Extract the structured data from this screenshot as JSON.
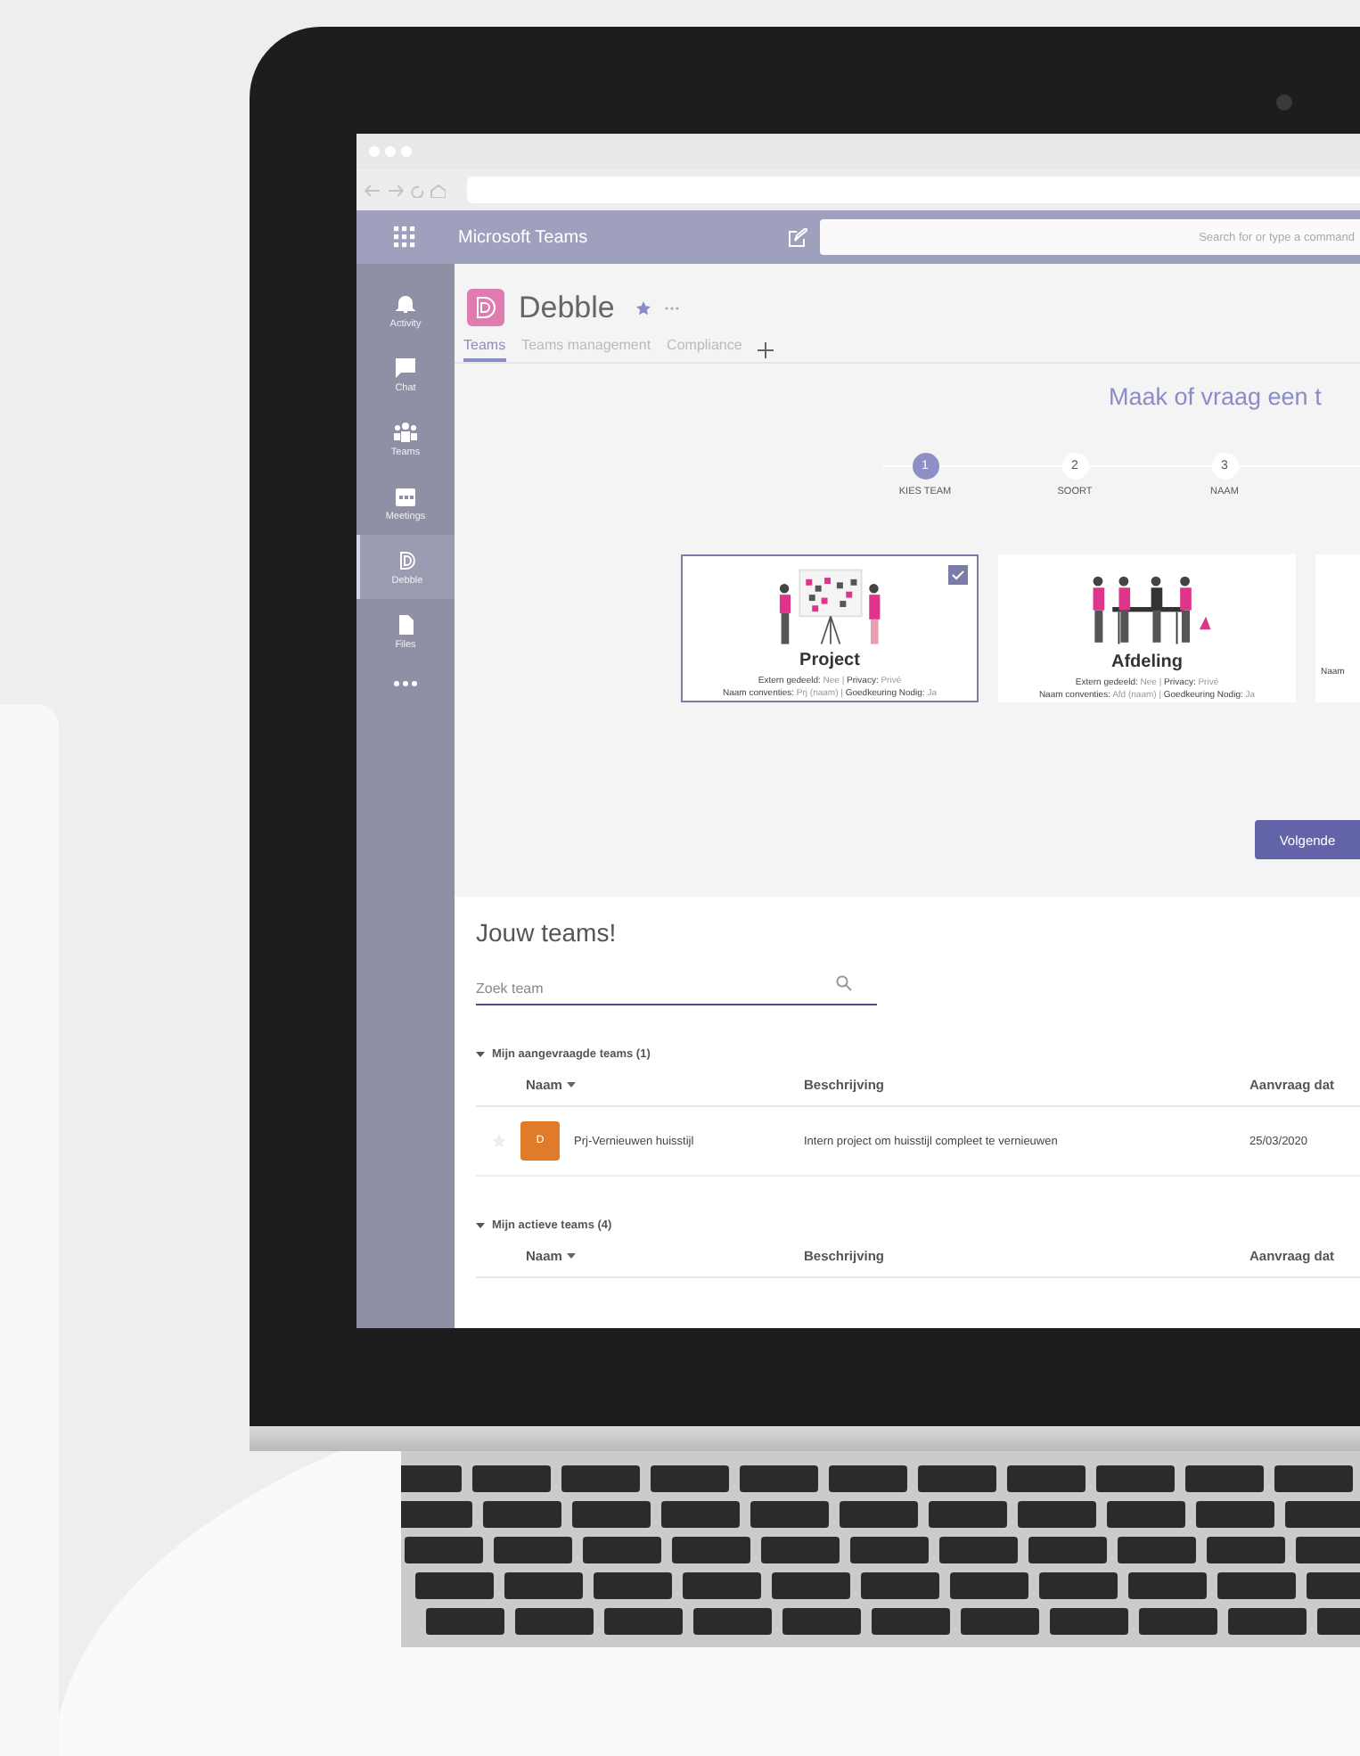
{
  "app_bar": {
    "title": "Microsoft Teams",
    "search_placeholder": "Search for or type a command"
  },
  "rail": [
    {
      "kind": "activity",
      "label": "Activity",
      "selected": false
    },
    {
      "kind": "chat",
      "label": "Chat",
      "selected": false
    },
    {
      "kind": "teams",
      "label": "Teams",
      "selected": false
    },
    {
      "kind": "meetings",
      "label": "Meetings",
      "selected": false
    },
    {
      "kind": "debble",
      "label": "Debble",
      "selected": true
    },
    {
      "kind": "files",
      "label": "Files",
      "selected": false
    }
  ],
  "app_header": {
    "name": "Debble",
    "tabs": [
      {
        "label": "Teams",
        "selected": true
      },
      {
        "label": "Teams management",
        "selected": false
      },
      {
        "label": "Compliance",
        "selected": false
      }
    ]
  },
  "wizard": {
    "title": "Maak of vraag een t",
    "steps": [
      {
        "number": "1",
        "label": "KIES TEAM",
        "selected": true
      },
      {
        "number": "2",
        "label": "SOORT",
        "selected": false
      },
      {
        "number": "3",
        "label": "NAAM",
        "selected": false
      }
    ],
    "cards": [
      {
        "kind": "project",
        "title": "Project",
        "line_1": "**Extern gedeeld:** Nee | **Privacy:** Privé",
        "line_2": "**Naam conventies:** Prj (naam) | **Goedkeuring Nodig:** Ja",
        "checked": true
      },
      {
        "kind": "department",
        "title": "Afdeling",
        "line_1": "**Extern gedeeld:** Nee | **Privacy:** Privé",
        "line_2": "**Naam conventies:** Afd (naam) | **Goedkeuring Nodig:** Ja",
        "checked": false
      },
      {
        "kind": "partial",
        "line_2": "**Naam**",
        "checked": false
      }
    ],
    "next_button": "Volgende"
  },
  "teams": {
    "title": "Jouw teams!",
    "search_placeholder": "Zoek team",
    "groups": [
      {
        "label": "Mijn aangevraagde teams (1)",
        "expanded": true,
        "columns": [
          "Naam",
          "Beschrijving",
          "Aanvraag dat"
        ],
        "rows": [
          {
            "initial": "D",
            "color": "#e07b2a",
            "name": "Prj-Vernieuwen huisstijl",
            "description": "Intern project om huisstijl compleet te vernieuwen",
            "date": "25/03/2020",
            "favorite": false
          }
        ]
      },
      {
        "label": "Mijn actieve teams (4)",
        "expanded": true,
        "columns": [
          "Naam",
          "Beschrijving",
          "Aanvraag dat"
        ]
      }
    ]
  }
}
